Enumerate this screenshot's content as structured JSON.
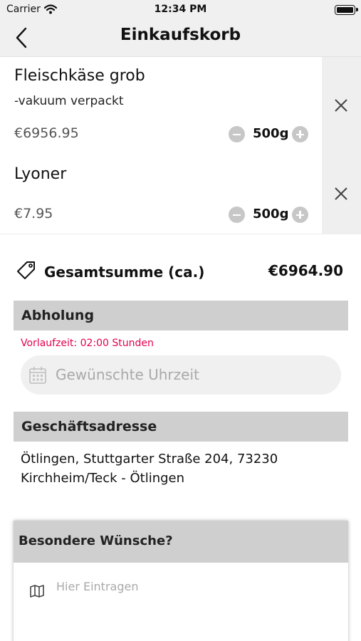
{
  "status_bar": {
    "carrier": "Carrier",
    "time": "12:34 PM"
  },
  "nav": {
    "title": "Einkaufskorb",
    "back_icon": "chevron-left-icon"
  },
  "cart": {
    "items": [
      {
        "name": "Fleischkäse grob",
        "description": "-vakuum verpackt",
        "price": "€6956.95",
        "quantity": "500g"
      },
      {
        "name": "Lyoner",
        "price": "€7.95",
        "quantity": "500g"
      }
    ],
    "remove_icon": "close-icon"
  },
  "total": {
    "label": "Gesamtsumme (ca.)",
    "value": "€6964.90",
    "icon": "price-tag-icon"
  },
  "pickup": {
    "header": "Abholung",
    "lead_time": "Vorlaufzeit: 02:00 Stunden",
    "time_placeholder": "Gewünschte Uhrzeit",
    "time_icon": "calendar-icon"
  },
  "address": {
    "header": "Geschäftsadresse",
    "line1": "Ötlingen, Stuttgarter Straße 204, 73230",
    "line2": "Kirchheim/Teck - Ötlingen"
  },
  "wishes": {
    "header": "Besondere Wünsche?",
    "placeholder": "Hier Eintragen",
    "icon": "map-icon"
  },
  "colors": {
    "lead_time": "#e4004f",
    "section_header_bg": "#cfcfcf",
    "nav_bg": "#f0f0f0",
    "placeholder": "#a9a9a9",
    "price": "#555555"
  }
}
